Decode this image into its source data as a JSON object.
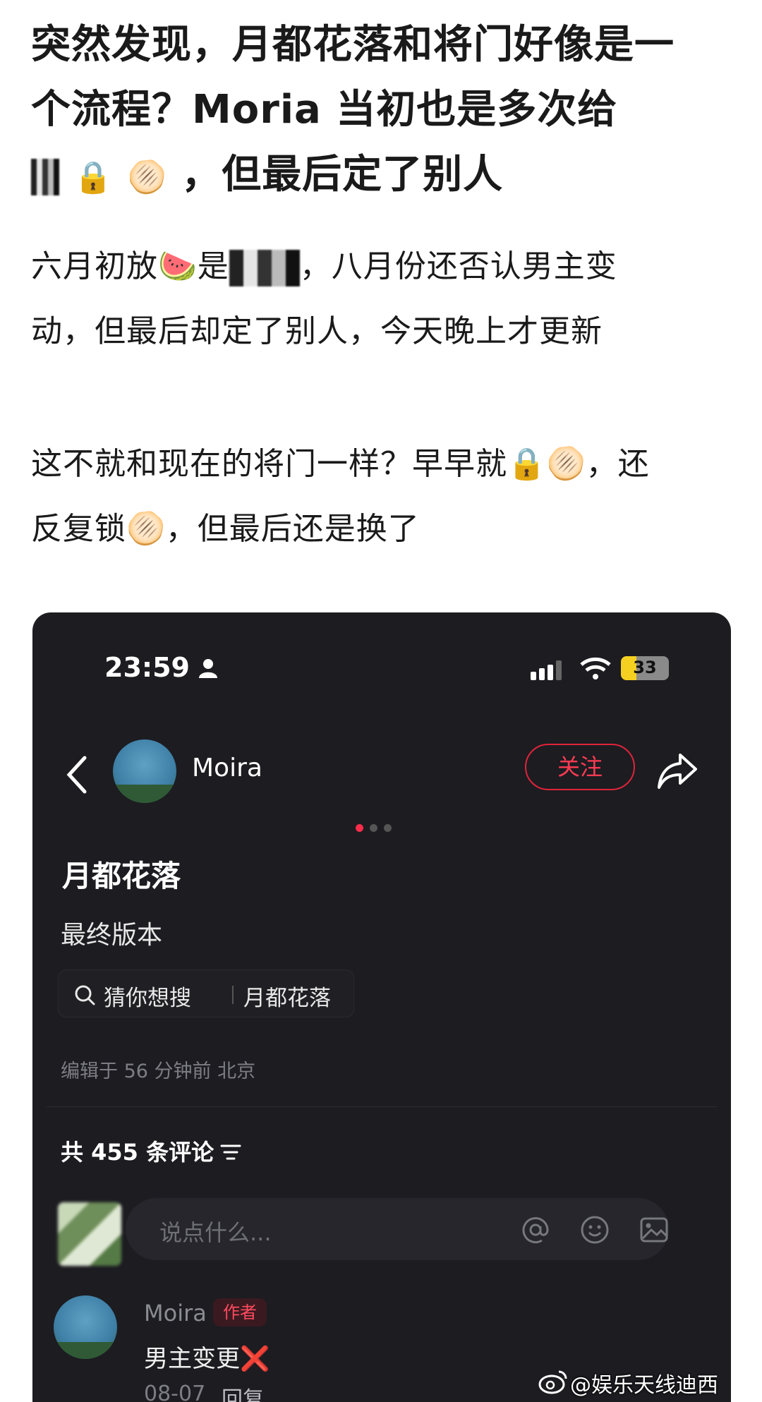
{
  "article": {
    "headline_line1": "突然发现，月都花落和将门好像是一",
    "headline_line2": "个流程？Moria 当初也是多次给",
    "headline_line3": "，但最后定了别人",
    "para1_line1_a": "六月初放",
    "para1_line1_b": "是",
    "para1_line1_c": "，八月份还否认男主变",
    "para1_line2": "动，但最后却定了别人，今天晚上才更新",
    "para2_line1_a": "这不就和现在的将门一样？早早就",
    "para2_line1_b": "，还",
    "para2_line2_a": "反复锁",
    "para2_line2_b": "，但最后还是换了",
    "emoji_lock": "🔒",
    "emoji_cookie": "🫓",
    "emoji_watermelon": "🍉"
  },
  "status_bar": {
    "time": "23:59",
    "battery": "33",
    "battery_level": 0.33
  },
  "post": {
    "author": "Moira",
    "follow_label": "关注",
    "title": "月都花落",
    "subtitle": "最终版本",
    "search_label": "猜你想搜",
    "search_term": "月都花落",
    "edited": "编辑于 56 分钟前 北京",
    "comment_count": "共 455 条评论",
    "input_placeholder": "说点什么..."
  },
  "comment": {
    "author": "Moira",
    "badge": "作者",
    "text": "男主变更",
    "mark": "❌",
    "date": "08-07",
    "reply_label": "回复"
  },
  "watermark": "@娱乐天线迪西",
  "colors": {
    "accent_red": "#ff2d4a",
    "dark_bg": "#1c1c21"
  }
}
